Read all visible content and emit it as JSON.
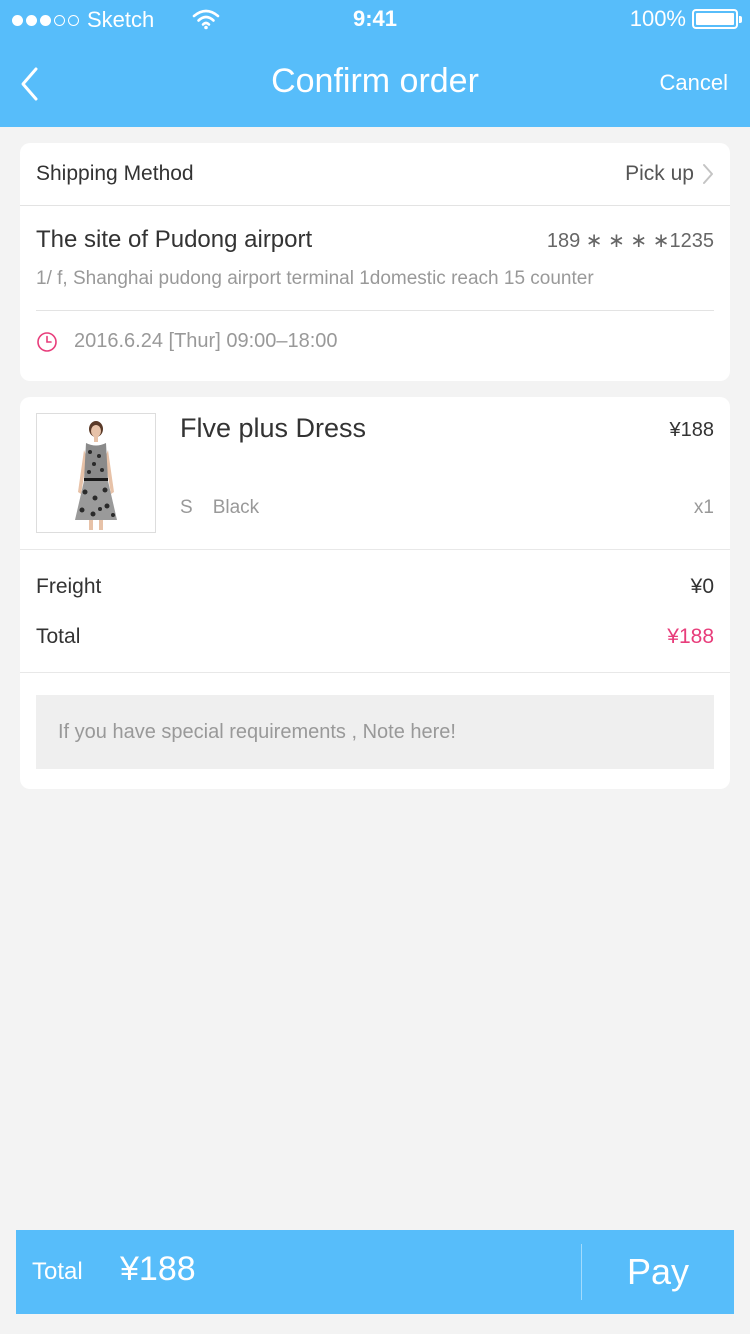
{
  "status_bar": {
    "carrier": "Sketch",
    "time": "9:41",
    "battery": "100%"
  },
  "nav": {
    "title": "Confirm order",
    "cancel_label": "Cancel",
    "back_icon": "chevron-left-icon"
  },
  "shipping": {
    "label": "Shipping Method",
    "value": "Pick up"
  },
  "site": {
    "name": "The site of Pudong airport",
    "phone": "189 ∗ ∗ ∗ ∗1235",
    "address": "1/ f, Shanghai pudong airport terminal 1domestic reach 15 counter",
    "time": "2016.6.24 [Thur] 09:00–18:00"
  },
  "product": {
    "name": "Flve plus Dress",
    "price": "¥188",
    "size": "S",
    "color": "Black",
    "qty": "x1"
  },
  "fees": {
    "freight_label": "Freight",
    "freight_value": "¥0",
    "total_label": "Total",
    "total_value": "¥188"
  },
  "note": {
    "placeholder": "If you have special requirements , Note here!"
  },
  "bottom_bar": {
    "total_label": "Total",
    "total_amount": "¥188",
    "pay_label": "Pay"
  },
  "colors": {
    "accent": "#57bdfa",
    "price_highlight": "#e83d7b",
    "background": "#f3f3f3"
  }
}
